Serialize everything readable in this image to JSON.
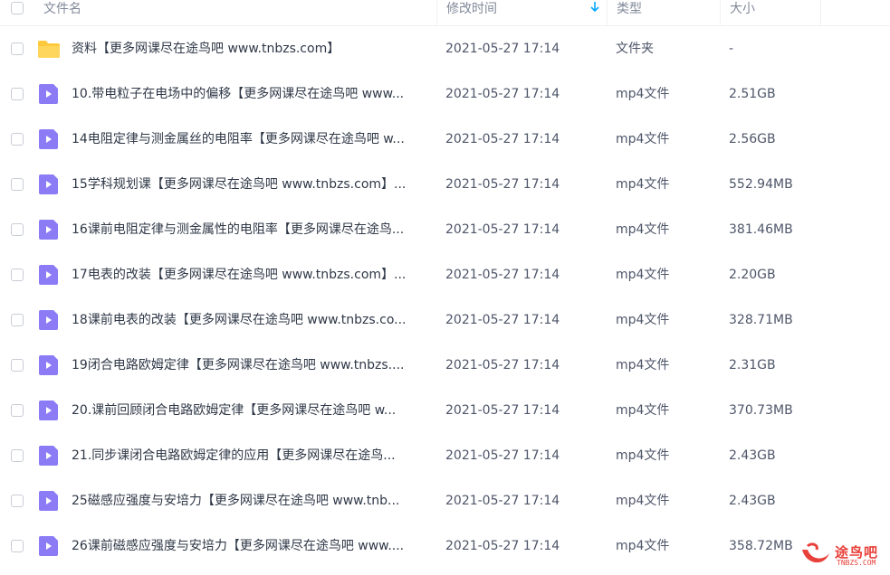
{
  "header": {
    "name": "文件名",
    "time": "修改时间",
    "type": "类型",
    "size": "大小",
    "sort_icon": "arrow-down-icon"
  },
  "rows": [
    {
      "icon": "folder-icon",
      "name": "资料【更多网课尽在途鸟吧 www.tnbzs.com】",
      "time": "2021-05-27 17:14",
      "type": "文件夹",
      "size": "-"
    },
    {
      "icon": "video-file-icon",
      "name": "10.带电粒子在电场中的偏移【更多网课尽在途鸟吧 www...",
      "time": "2021-05-27 17:14",
      "type": "mp4文件",
      "size": "2.51GB"
    },
    {
      "icon": "video-file-icon",
      "name": "14电阻定律与测金属丝的电阻率【更多网课尽在途鸟吧 w...",
      "time": "2021-05-27 17:14",
      "type": "mp4文件",
      "size": "2.56GB"
    },
    {
      "icon": "video-file-icon",
      "name": "15学科规划课【更多网课尽在途鸟吧 www.tnbzs.com】...",
      "time": "2021-05-27 17:14",
      "type": "mp4文件",
      "size": "552.94MB"
    },
    {
      "icon": "video-file-icon",
      "name": "16课前电阻定律与测金属性的电阻率【更多网课尽在途鸟...",
      "time": "2021-05-27 17:14",
      "type": "mp4文件",
      "size": "381.46MB"
    },
    {
      "icon": "video-file-icon",
      "name": "17电表的改装【更多网课尽在途鸟吧 www.tnbzs.com】...",
      "time": "2021-05-27 17:14",
      "type": "mp4文件",
      "size": "2.20GB"
    },
    {
      "icon": "video-file-icon",
      "name": "18课前电表的改装【更多网课尽在途鸟吧 www.tnbzs.co...",
      "time": "2021-05-27 17:14",
      "type": "mp4文件",
      "size": "328.71MB"
    },
    {
      "icon": "video-file-icon",
      "name": "19闭合电路欧姆定律【更多网课尽在途鸟吧 www.tnbzs....",
      "time": "2021-05-27 17:14",
      "type": "mp4文件",
      "size": "2.31GB"
    },
    {
      "icon": "video-file-icon",
      "name": "20.课前回顾闭合电路欧姆定律【更多网课尽在途鸟吧 w...",
      "time": "2021-05-27 17:14",
      "type": "mp4文件",
      "size": "370.73MB"
    },
    {
      "icon": "video-file-icon",
      "name": "21.同步课闭合电路欧姆定律的应用【更多网课尽在途鸟...",
      "time": "2021-05-27 17:14",
      "type": "mp4文件",
      "size": "2.43GB"
    },
    {
      "icon": "video-file-icon",
      "name": "25磁感应强度与安培力【更多网课尽在途鸟吧 www.tnb...",
      "time": "2021-05-27 17:14",
      "type": "mp4文件",
      "size": "2.43GB"
    },
    {
      "icon": "video-file-icon",
      "name": "26课前磁感应强度与安培力【更多网课尽在途鸟吧 www....",
      "time": "2021-05-27 17:14",
      "type": "mp4文件",
      "size": "358.72MB"
    }
  ],
  "watermark": {
    "title": "途鸟吧",
    "subtitle": "TNBZS.COM"
  },
  "colors": {
    "folder": "#ffc93c",
    "video": "#8b7cf6",
    "accent": "#06a7ff",
    "watermark": "#e8413a"
  }
}
